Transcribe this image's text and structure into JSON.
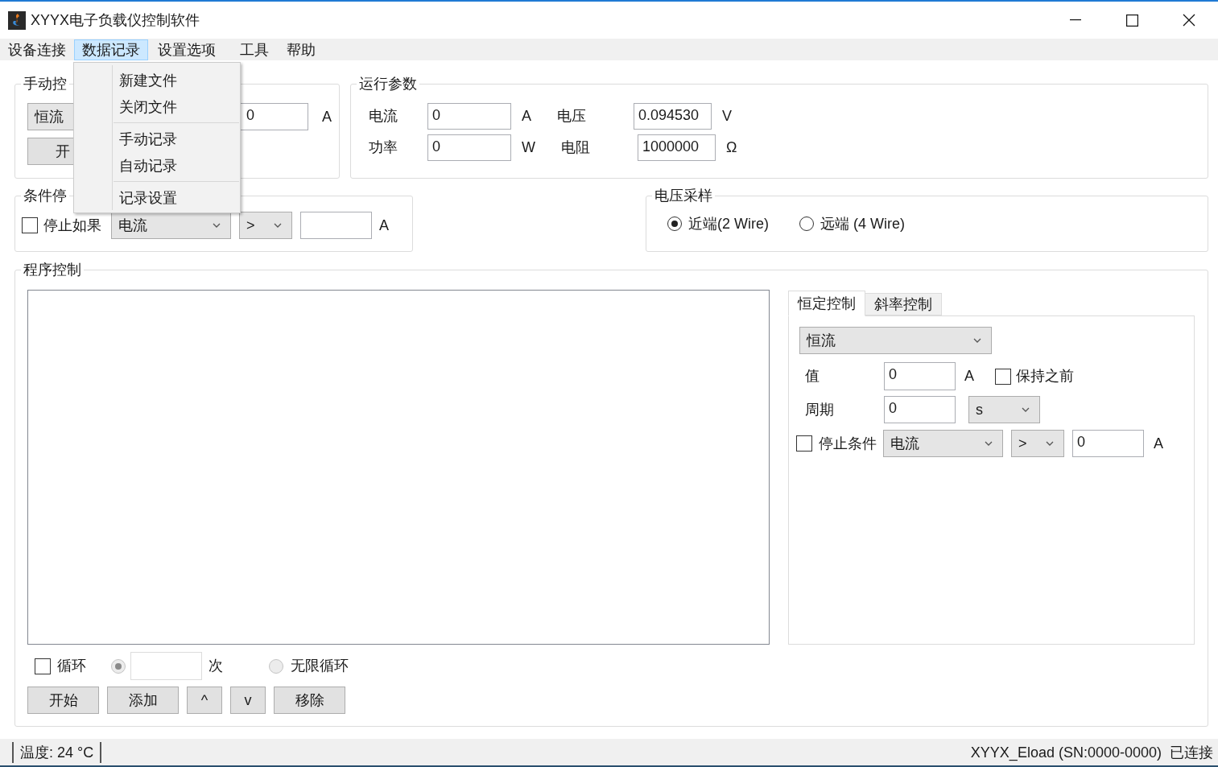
{
  "window": {
    "title": "XYYX电子负载仪控制软件"
  },
  "menu_bar": [
    {
      "label": "设备连接",
      "selected": false
    },
    {
      "label": "数据记录",
      "selected": true
    },
    {
      "label": "设置选项",
      "selected": false
    },
    {
      "label": "工具",
      "selected": false
    },
    {
      "label": "帮助",
      "selected": false
    }
  ],
  "open_menu": {
    "items": [
      {
        "label": "新建文件",
        "separator_before": false
      },
      {
        "label": "关闭文件",
        "separator_before": false
      },
      {
        "label": "手动记录",
        "separator_before": true
      },
      {
        "label": "自动记录",
        "separator_before": false
      },
      {
        "label": "记录设置",
        "separator_before": true
      }
    ]
  },
  "manual_control": {
    "title": "手动控",
    "mode": "恒流",
    "value": "0",
    "unit": "A",
    "start_button": "开"
  },
  "run_params": {
    "title": "运行参数",
    "fields": [
      {
        "label": "电流",
        "value": "0",
        "unit": "A"
      },
      {
        "label": "电压",
        "value": "0.094530",
        "unit": "V"
      },
      {
        "label": "功率",
        "value": "0",
        "unit": "W"
      },
      {
        "label": "电阻",
        "value": "1000000",
        "unit": "Ω"
      }
    ]
  },
  "condition_stop": {
    "title": "条件停",
    "label": "停止如果",
    "checked": false,
    "quantity": "电流",
    "operator": ">",
    "unit": "A"
  },
  "voltage_sampling": {
    "title": "电压采样",
    "options": [
      {
        "label": "近端(2 Wire)",
        "selected": true
      },
      {
        "label": "远端 (4 Wire)",
        "selected": false
      }
    ]
  },
  "program_control": {
    "title": "程序控制",
    "tabs": [
      {
        "label": "恒定控制",
        "selected": true
      },
      {
        "label": "斜率控制",
        "selected": false
      }
    ],
    "mode": "恒流",
    "value": {
      "label": "值",
      "value": "0",
      "unit": "A"
    },
    "hold_previous": {
      "label": "保持之前",
      "checked": false
    },
    "period": {
      "label": "周期",
      "value": "0",
      "unit": "s"
    },
    "stop_condition": {
      "label": "停止条件",
      "checked": false,
      "quantity": "电流",
      "operator": ">",
      "value": "0",
      "unit": "A"
    },
    "loop": {
      "label": "循环",
      "checked": false
    },
    "count_option": {
      "selected": true,
      "disabled": true,
      "unit": "次"
    },
    "infinite_option": {
      "label": "无限循环",
      "selected": false,
      "disabled": true
    },
    "buttons": [
      "开始",
      "添加",
      "^",
      "v",
      "移除"
    ]
  },
  "status_bar": {
    "temperature": "温度: 24 °C",
    "device": "XYYX_Eload (SN:0000-0000)",
    "connection": "已连接"
  }
}
